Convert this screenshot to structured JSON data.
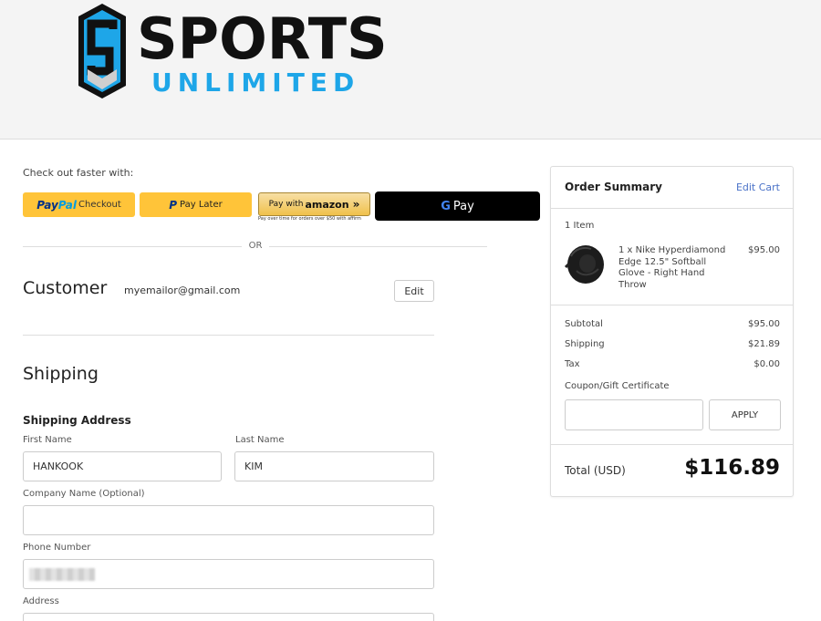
{
  "header": {
    "brand_line1": "SPORTS",
    "brand_line2": "UNLIMITED",
    "brand_color": "#1ea6e8"
  },
  "express_checkout": {
    "label": "Check out faster with:",
    "paypal_brand": "Pay",
    "paypal_brand2": "Pal",
    "paypal_text": "Checkout",
    "paylater_text": "Pay Later",
    "amazon_prefix": "Pay with",
    "amazon_brand": "amazon",
    "amazon_note": "Pay over time for orders over $50 with affirm",
    "gpay_g": "G",
    "gpay_text": "Pay",
    "separator": "OR"
  },
  "customer": {
    "title": "Customer",
    "email": "myemailor@gmail.com",
    "edit_label": "Edit"
  },
  "shipping": {
    "title": "Shipping",
    "address_heading": "Shipping Address",
    "first_name_label": "First Name",
    "first_name_value": "HANKOOK",
    "last_name_label": "Last Name",
    "last_name_value": "KIM",
    "company_label": "Company Name (Optional)",
    "company_value": "",
    "phone_label": "Phone Number",
    "address_label": "Address"
  },
  "summary": {
    "title": "Order Summary",
    "edit_cart": "Edit Cart",
    "item_count": "1 Item",
    "item_name": "1 x Nike Hyperdiamond Edge 12.5\" Softball Glove - Right Hand Throw",
    "item_price": "$95.00",
    "subtotal_label": "Subtotal",
    "subtotal_value": "$95.00",
    "shipping_label": "Shipping",
    "shipping_value": "$21.89",
    "tax_label": "Tax",
    "tax_value": "$0.00",
    "coupon_label": "Coupon/Gift Certificate",
    "coupon_value": "",
    "apply_label": "APPLY",
    "total_label": "Total (USD)",
    "total_value": "$116.89"
  }
}
